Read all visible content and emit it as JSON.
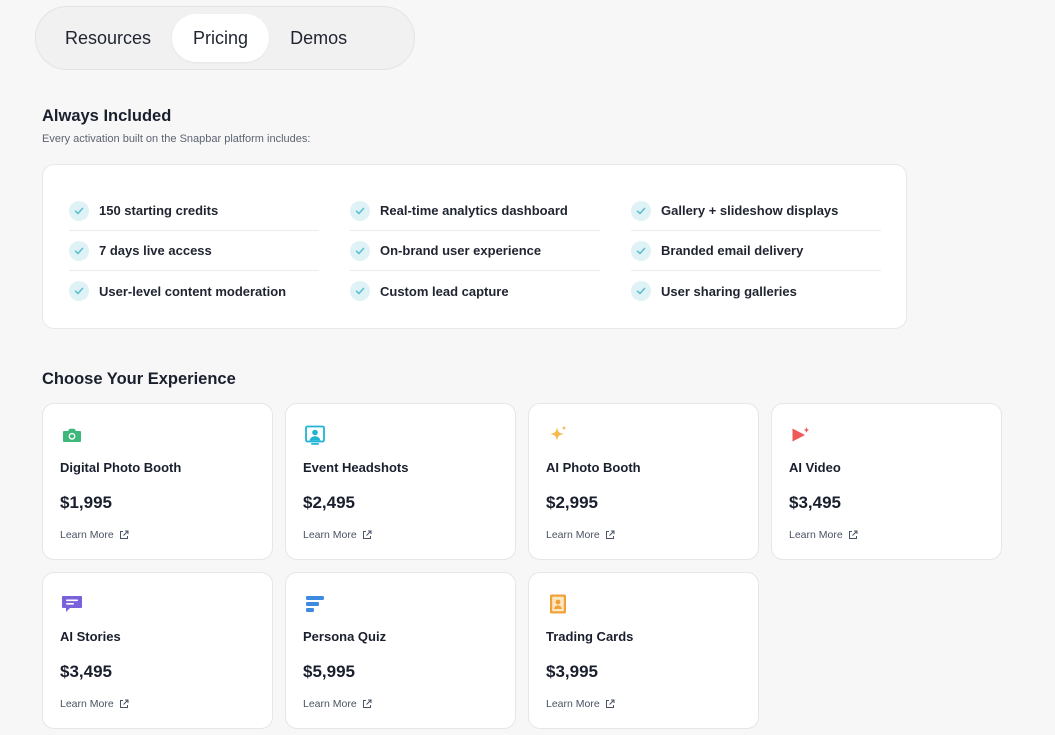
{
  "nav": {
    "items": [
      {
        "label": "Resources",
        "active": false
      },
      {
        "label": "Pricing",
        "active": true
      },
      {
        "label": "Demos",
        "active": false
      }
    ]
  },
  "included": {
    "title": "Always Included",
    "subtitle": "Every activation built on the Snapbar platform includes:",
    "columns": [
      [
        "150 starting credits",
        "7 days live access",
        "User-level content moderation"
      ],
      [
        "Real-time analytics dashboard",
        "On-brand user experience",
        "Custom lead capture"
      ],
      [
        "Gallery + slideshow displays",
        "Branded email delivery",
        "User sharing galleries"
      ]
    ]
  },
  "experience": {
    "title": "Choose Your Experience",
    "link_label": "Learn More",
    "cards": [
      {
        "title": "Digital Photo Booth",
        "price": "$1,995",
        "icon": "camera-icon"
      },
      {
        "title": "Event Headshots",
        "price": "$2,495",
        "icon": "headshot-icon"
      },
      {
        "title": "AI Photo Booth",
        "price": "$2,995",
        "icon": "sparkle-icon"
      },
      {
        "title": "AI Video",
        "price": "$3,495",
        "icon": "video-sparkle-icon"
      },
      {
        "title": "AI Stories",
        "price": "$3,495",
        "icon": "chat-icon"
      },
      {
        "title": "Persona Quiz",
        "price": "$5,995",
        "icon": "quiz-icon"
      },
      {
        "title": "Trading Cards",
        "price": "$3,995",
        "icon": "trading-card-icon"
      }
    ]
  },
  "colors": {
    "check": "#5bc0cf",
    "camera": "#3db77a",
    "headshot": "#1fb3d6",
    "sparkle": "#f5b84a",
    "video": "#ee5a5a",
    "chat": "#7b61d9",
    "quiz": "#3d8be0",
    "card": "#f0a23a"
  }
}
